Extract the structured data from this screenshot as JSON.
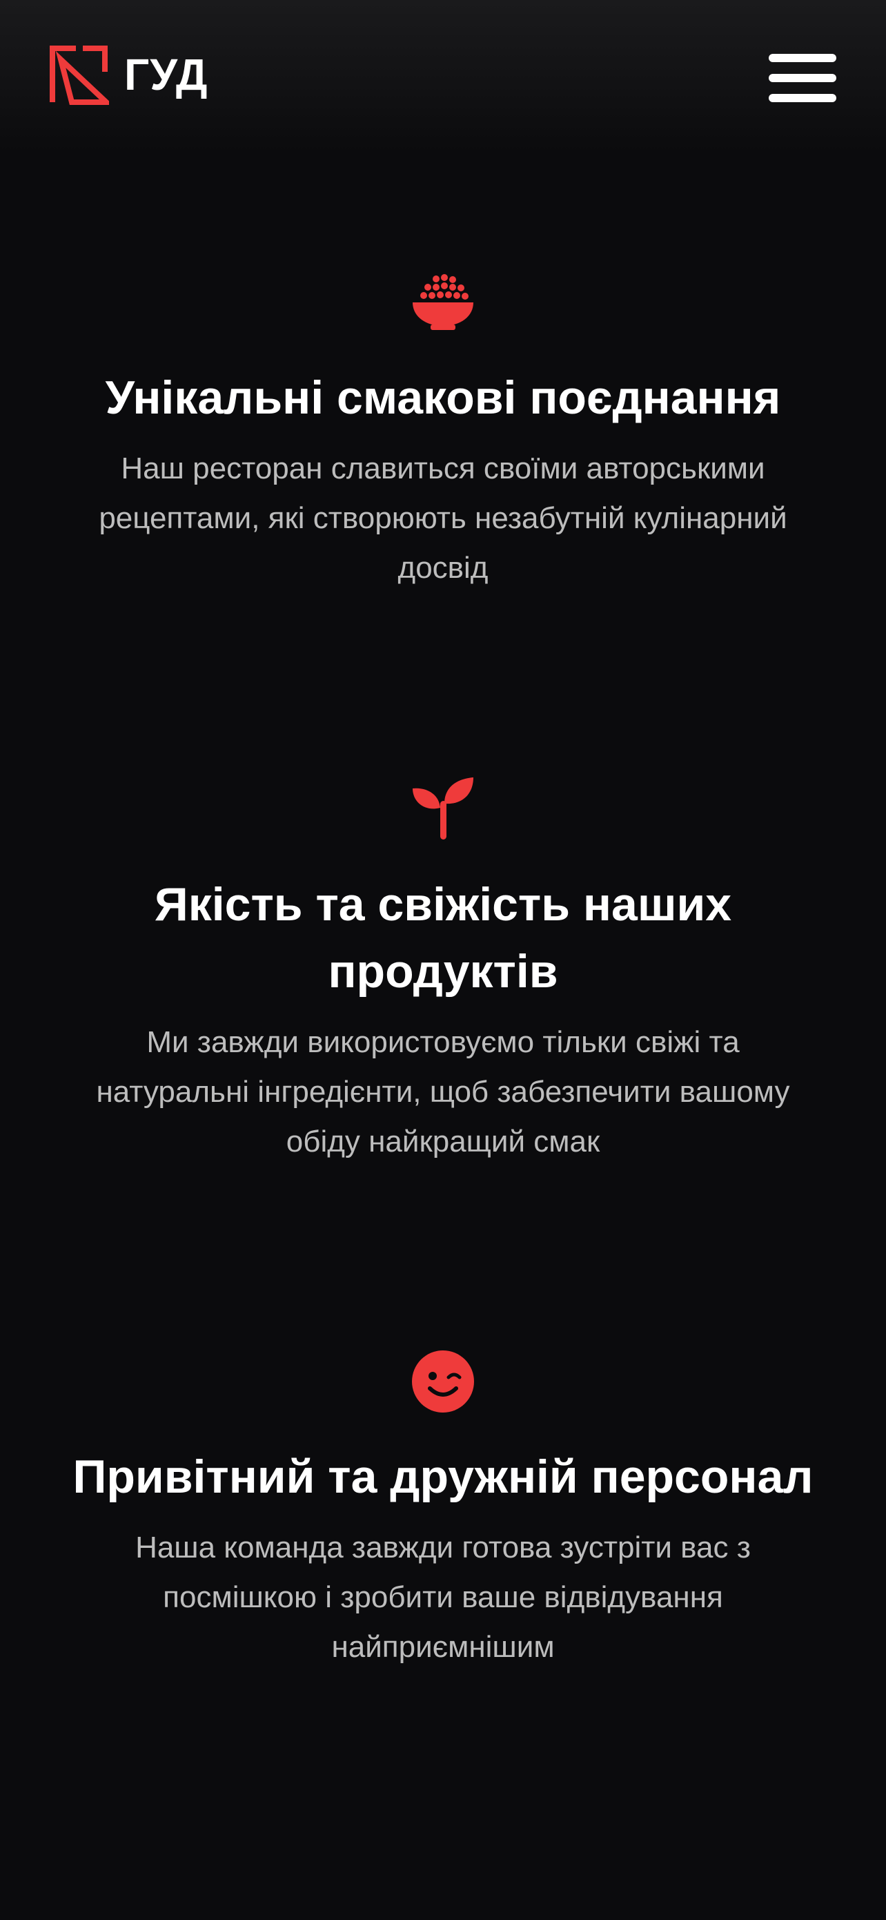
{
  "brand": {
    "name": "ГУД",
    "accent_color": "#ef3b3b",
    "logo_icon": "brand-logo-icon"
  },
  "header": {
    "menu_icon": "hamburger-menu-icon"
  },
  "features": [
    {
      "icon": "rice-bowl-icon",
      "title": "Унікальні смакові поєднання",
      "description": "Наш ресторан славиться своїми авторськими рецептами, які створюють незабутній кулінарний досвід"
    },
    {
      "icon": "sprout-icon",
      "title": "Якість та свіжість наших продуктів",
      "description": "Ми завжди використовуємо тільки свіжі та натуральні інгредієнти, щоб забезпечити вашому обіду найкращий смак"
    },
    {
      "icon": "wink-face-icon",
      "title": "Привітний та дружній персонал",
      "description": "Наша команда завжди готова зустріти вас з посмішкою і зробити ваше відвідування найприємнішим"
    }
  ]
}
